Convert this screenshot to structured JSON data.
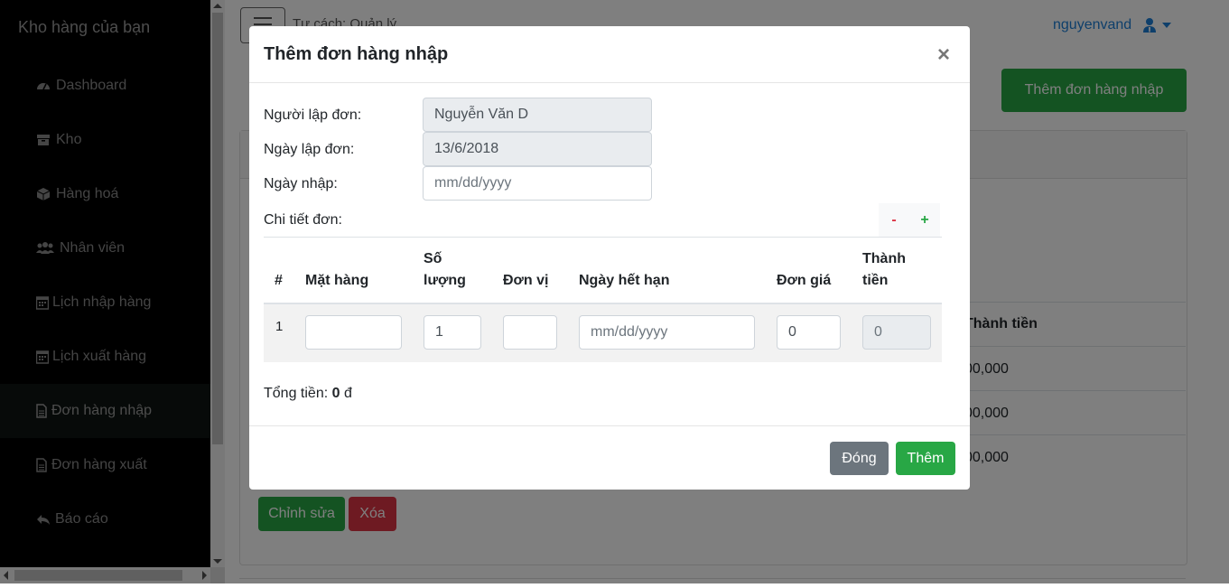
{
  "sidebar": {
    "brand": "Kho hàng của bạn",
    "items": [
      {
        "label": "Dashboard",
        "icon": "tachometer-icon"
      },
      {
        "label": "Kho",
        "icon": "archive-icon"
      },
      {
        "label": "Hàng hoá",
        "icon": "cube-icon"
      },
      {
        "label": "Nhân viên",
        "icon": "users-icon"
      },
      {
        "label": "Lịch nhập hàng",
        "icon": "calendar-icon"
      },
      {
        "label": "Lịch xuất hàng",
        "icon": "calendar-icon"
      },
      {
        "label": "Đơn hàng nhập",
        "icon": "file-icon",
        "active": true
      },
      {
        "label": "Đơn hàng xuất",
        "icon": "file-icon"
      },
      {
        "label": "Báo cáo",
        "icon": "reply-icon"
      }
    ]
  },
  "header": {
    "role": "Tư cách: Quản lý",
    "username": "nguyenvand"
  },
  "main": {
    "add_order_label": "Thêm đơn hàng nhập",
    "table_header": "Thành tiền",
    "rows": [
      "00,000",
      "00,000",
      "00,000"
    ],
    "edit_label": "Chỉnh sửa",
    "delete_label": "Xóa"
  },
  "modal": {
    "title": "Thêm đơn hàng nhập",
    "close_symbol": "×",
    "fields": {
      "creator_label": "Người lập đơn:",
      "creator_value": "Nguyễn Văn D",
      "created_label": "Ngày lập đơn:",
      "created_value": "13/6/2018",
      "import_label": "Ngày nhập:",
      "import_placeholder": "mm/dd/yyyy"
    },
    "details_label": "Chi tiết đơn:",
    "minus_label": "-",
    "plus_label": "+",
    "table": {
      "headers": [
        "#",
        "Mặt hàng",
        "Số lượng",
        "Đơn vị",
        "Ngày hết hạn",
        "Đơn giá",
        "Thành tiền"
      ],
      "headers_wrapped": {
        "qty": [
          "Số",
          "lượng"
        ],
        "total": [
          "Thành",
          "tiền"
        ]
      },
      "row": {
        "index": "1",
        "item": "",
        "quantity": "1",
        "unit": "",
        "expiry_placeholder": "mm/dd/yyyy",
        "price": "0",
        "total": "0"
      }
    },
    "total_label": "Tổng tiền: ",
    "total_value": "0",
    "currency": " đ",
    "close_button": "Đóng",
    "submit_button": "Thêm"
  },
  "colors": {
    "accent_green": "#28a745",
    "danger": "#dc3545",
    "secondary": "#6c757d",
    "link": "#1c7ed6"
  }
}
